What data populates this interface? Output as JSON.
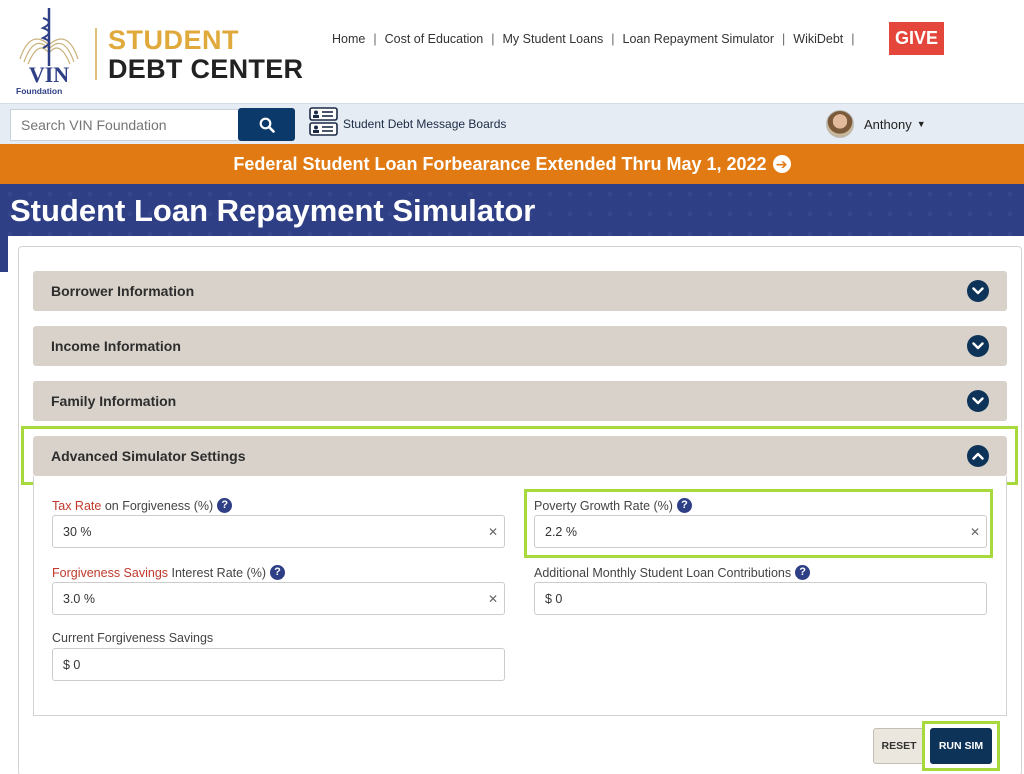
{
  "header": {
    "logo_text": "VIN",
    "logo_sub": "Foundation",
    "brand_line1": "STUDENT",
    "brand_line2": "DEBT CENTER",
    "nav": [
      {
        "label": "Home"
      },
      {
        "label": "Cost of Education"
      },
      {
        "label": "My Student Loans"
      },
      {
        "label": "Loan Repayment Simulator"
      },
      {
        "label": "WikiDebt"
      }
    ],
    "give_label": "GIVE"
  },
  "toolbar": {
    "search_placeholder": "Search VIN Foundation",
    "message_boards_label": "Student Debt Message Boards",
    "user_name": "Anthony"
  },
  "banner": {
    "text": "Federal Student Loan Forbearance Extended Thru May 1, 2022"
  },
  "page": {
    "title": "Student Loan Repayment Simulator"
  },
  "accordion": [
    {
      "label": "Borrower Information",
      "expanded": false
    },
    {
      "label": "Income Information",
      "expanded": false
    },
    {
      "label": "Family Information",
      "expanded": false
    },
    {
      "label": "Advanced Simulator Settings",
      "expanded": true
    }
  ],
  "advanced": {
    "tax_rate": {
      "label_red": "Tax Rate",
      "label_rest": " on Forgiveness (%)",
      "value": "30 %"
    },
    "poverty_growth": {
      "label": "Poverty Growth Rate (%)",
      "value": "2.2 %"
    },
    "savings_rate": {
      "label_red": "Forgiveness Savings",
      "label_rest": " Interest Rate (%)",
      "value": "3.0 %"
    },
    "monthly_contrib": {
      "label": "Additional Monthly Student Loan Contributions",
      "value": "$ 0"
    },
    "current_savings": {
      "label": "Current Forgiveness Savings",
      "value": "$ 0"
    }
  },
  "actions": {
    "reset_label": "RESET",
    "run_label": "RUN SIM"
  },
  "colors": {
    "brand_gold": "#e0a93c",
    "navy": "#0e3359",
    "banner_orange": "#e17a12",
    "title_blue": "#2f3f86",
    "highlight_green": "#a7d93d",
    "give_red": "#e4463b"
  }
}
